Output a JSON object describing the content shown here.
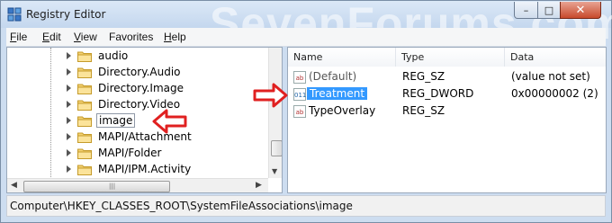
{
  "window": {
    "title": "Registry Editor",
    "watermark": "SevenForums.com",
    "controls": {
      "minimize": "–",
      "maximize": "□",
      "close": "✕"
    }
  },
  "menu": [
    {
      "accel": "F",
      "rest": "ile"
    },
    {
      "accel": "E",
      "rest": "dit"
    },
    {
      "accel": "V",
      "rest": "iew"
    },
    {
      "accel": "",
      "rest": "Favorites"
    },
    {
      "accel": "H",
      "rest": "elp"
    }
  ],
  "tree": {
    "items": [
      {
        "label": "audio",
        "selected": false
      },
      {
        "label": "Directory.Audio",
        "selected": false
      },
      {
        "label": "Directory.Image",
        "selected": false
      },
      {
        "label": "Directory.Video",
        "selected": false
      },
      {
        "label": "image",
        "selected": true
      },
      {
        "label": "MAPI/Attachment",
        "selected": false
      },
      {
        "label": "MAPI/Folder",
        "selected": false
      },
      {
        "label": "MAPI/IPM.Activity",
        "selected": false
      }
    ]
  },
  "list": {
    "columns": {
      "name": "Name",
      "type": "Type",
      "data": "Data"
    },
    "rows": [
      {
        "name": "(Default)",
        "type": "REG_SZ",
        "data": "(value not set)",
        "icon": "string-value-icon",
        "icon_text": "ab"
      },
      {
        "name": "Treatment",
        "type": "REG_DWORD",
        "data": "0x00000002 (2)",
        "icon": "dword-value-icon",
        "icon_text": "011"
      },
      {
        "name": "TypeOverlay",
        "type": "REG_SZ",
        "data": "",
        "icon": "string-value-icon",
        "icon_text": "ab"
      }
    ]
  },
  "status": {
    "path": "Computer\\HKEY_CLASSES_ROOT\\SystemFileAssociations\\image"
  },
  "colors": {
    "annotation_arrow": "#e02020",
    "selection": "#3399ff"
  }
}
